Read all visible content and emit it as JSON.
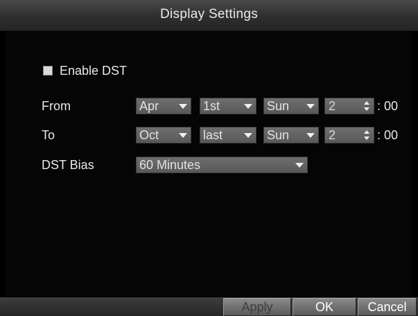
{
  "window": {
    "title": "Display Settings"
  },
  "dst": {
    "enable_label": "Enable DST",
    "enabled": false,
    "from": {
      "label": "From",
      "month": "Apr",
      "week": "1st",
      "day": "Sun",
      "hour": "2",
      "suffix": ": 00"
    },
    "to": {
      "label": "To",
      "month": "Oct",
      "week": "last",
      "day": "Sun",
      "hour": "2",
      "suffix": ": 00"
    },
    "bias": {
      "label": "DST Bias",
      "value": "60 Minutes"
    }
  },
  "buttons": {
    "apply": "Apply",
    "ok": "OK",
    "cancel": "Cancel"
  }
}
